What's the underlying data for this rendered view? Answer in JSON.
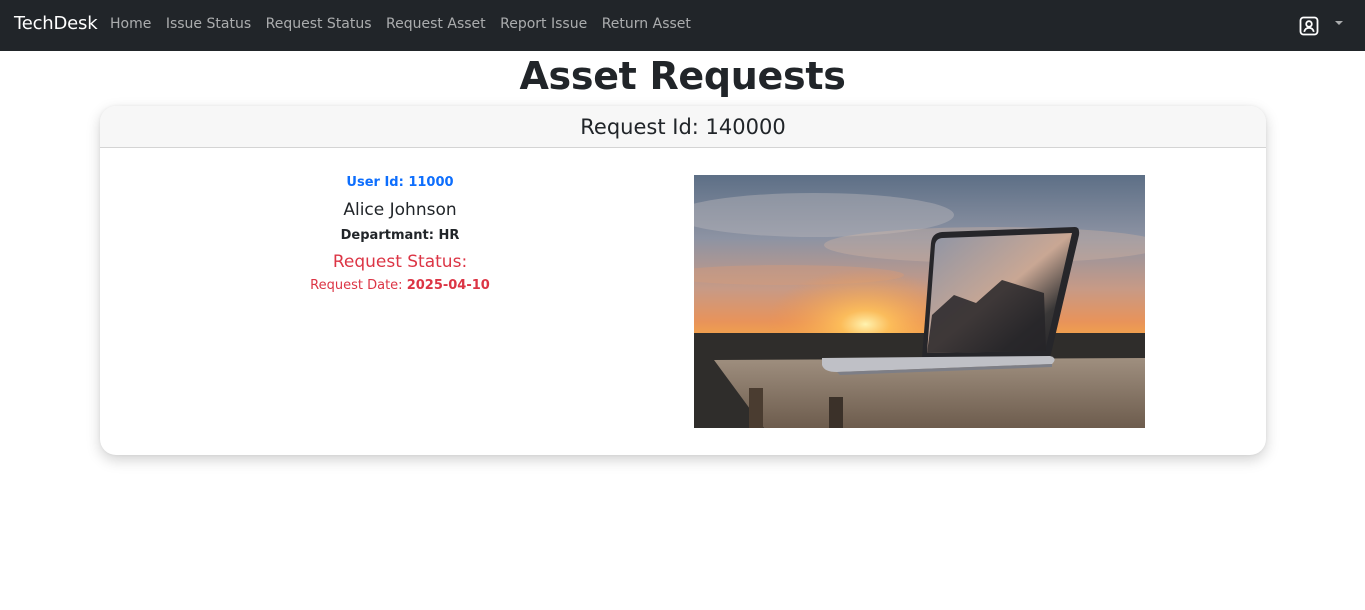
{
  "navbar": {
    "brand": "TechDesk",
    "links": [
      "Home",
      "Issue Status",
      "Request Status",
      "Request Asset",
      "Report Issue",
      "Return Asset"
    ],
    "user_icon": "person-badge-icon",
    "dropdown_icon": "caret-down-icon"
  },
  "page": {
    "title": "Asset Requests"
  },
  "request": {
    "header": "Request Id: 140000",
    "user_id": "User Id: 11000",
    "name": "Alice Johnson",
    "department": "Departmant: HR",
    "status_label": "Request Status:",
    "date_label": "Request Date:",
    "date_value": "2025-04-10",
    "image": "laptop-on-table-at-sunset"
  },
  "colors": {
    "navbar_bg": "#212529",
    "link": "#0d6efd",
    "danger": "#dc3545"
  }
}
